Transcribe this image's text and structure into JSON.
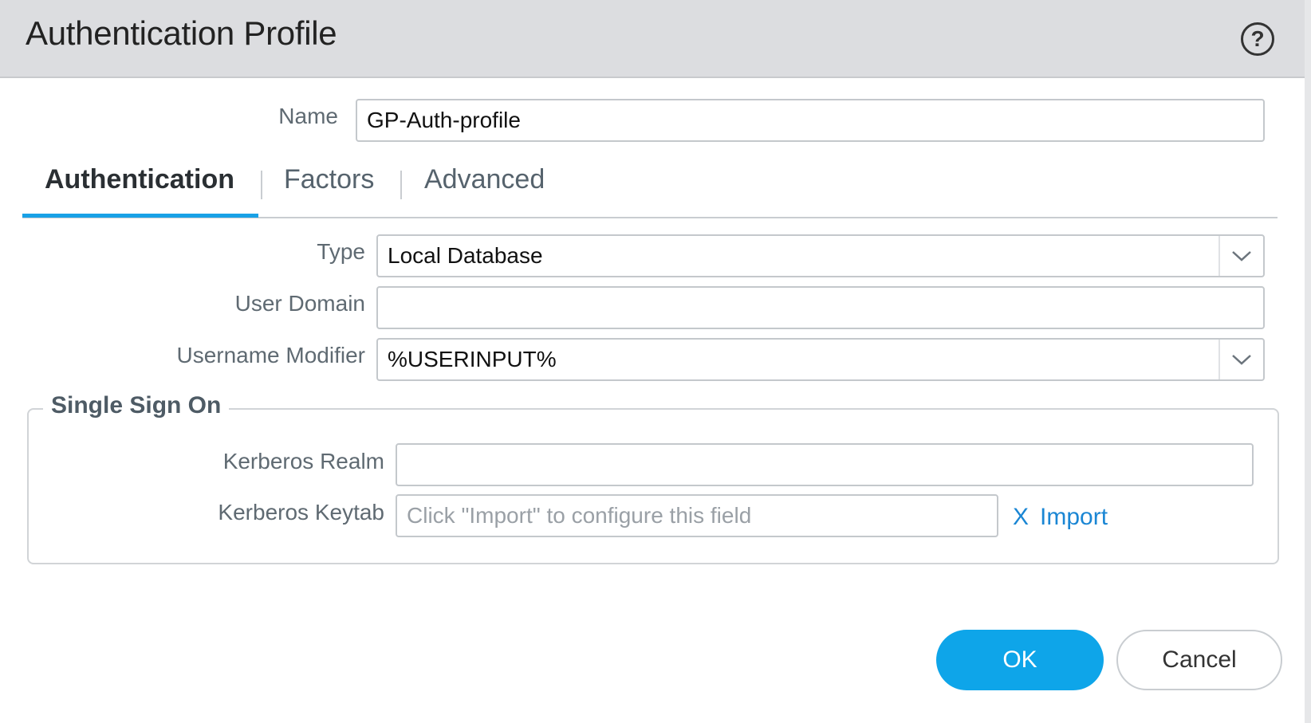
{
  "dialog": {
    "title": "Authentication Profile",
    "help_icon": "question-circle-icon"
  },
  "form": {
    "name_label": "Name",
    "name_value": "GP-Auth-profile"
  },
  "tabs": [
    {
      "label": "Authentication",
      "active": true
    },
    {
      "label": "Factors",
      "active": false
    },
    {
      "label": "Advanced",
      "active": false
    }
  ],
  "auth": {
    "type_label": "Type",
    "type_value": "Local Database",
    "user_domain_label": "User Domain",
    "user_domain_value": "",
    "username_modifier_label": "Username Modifier",
    "username_modifier_value": "%USERINPUT%"
  },
  "sso": {
    "legend": "Single Sign On",
    "kerberos_realm_label": "Kerberos Realm",
    "kerberos_realm_value": "",
    "kerberos_keytab_label": "Kerberos Keytab",
    "kerberos_keytab_placeholder": "Click \"Import\" to configure this field",
    "clear_label": "X",
    "import_label": "Import"
  },
  "footer": {
    "ok_label": "OK",
    "cancel_label": "Cancel"
  },
  "colors": {
    "accent": "#0ea5e9",
    "tab_underline": "#19a1e6",
    "link": "#1a86d4",
    "titlebar_bg": "#dcdde0"
  }
}
